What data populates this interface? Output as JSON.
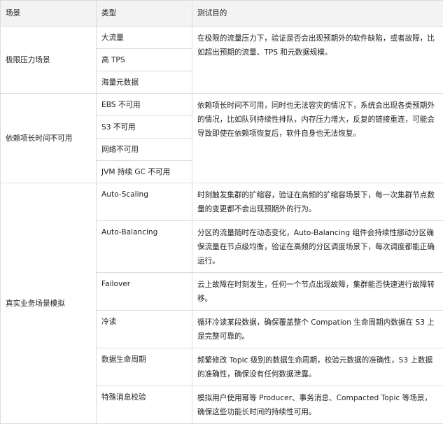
{
  "table": {
    "headers": [
      "场景",
      "类型",
      "测试目的"
    ],
    "groups": [
      {
        "scenario": "极限压力场景",
        "types": [
          "大流量",
          "高 TPS",
          "海量元数据"
        ],
        "purpose": "在极限的流量压力下，验证是否会出现预期外的软件缺陷，或者故障，比如超出预期的流量、TPS 和元数据规模。"
      },
      {
        "scenario": "依赖项长时间不可用",
        "types": [
          "EBS 不可用",
          "S3 不可用",
          "网络不可用",
          "JVM 持续 GC 不可用"
        ],
        "purpose": "依赖项长时间不可用，同时也无法容灾的情况下，系统会出现各类预期外的情况，比如队列持续性排队，内存压力增大，反复的链接重连，可能会导致即使在依赖项恢复后，软件自身也无法恢复。"
      },
      {
        "scenario": "真实业务场景模拟",
        "rows": [
          {
            "type": "Auto-Scaling",
            "purpose": "时刻触发集群的扩缩容，验证在高频的扩缩容场景下，每一次集群节点数量的变更都不会出现预期外的行为。"
          },
          {
            "type": "Auto-Balancing",
            "purpose": "分区的流量随时在动态变化，Auto-Balancing 组件会持续性挪动分区确保流量在节点级均衡，验证在高频的分区调度场景下，每次调度都能正确运行。"
          },
          {
            "type": "Failover",
            "purpose": "云上故障在时刻发生，任何一个节点出现故障，集群能否快速进行故障转移。"
          },
          {
            "type": "冷读",
            "purpose": "循环冷读某段数据，确保覆盖整个 Compation 生命周期内数据在 S3 上是完整可靠的。"
          },
          {
            "type": "数据生命周期",
            "purpose": "频繁修改 Topic 级别的数据生命周期，校验元数据的准确性，S3 上数据的准确性，确保没有任何数据泄露。"
          },
          {
            "type": "特殊消息校验",
            "purpose": "模拟用户使用幂等 Producer、事务消息、Compacted Topic 等场景，确保这些功能长时间的持续性可用。"
          }
        ]
      }
    ]
  }
}
